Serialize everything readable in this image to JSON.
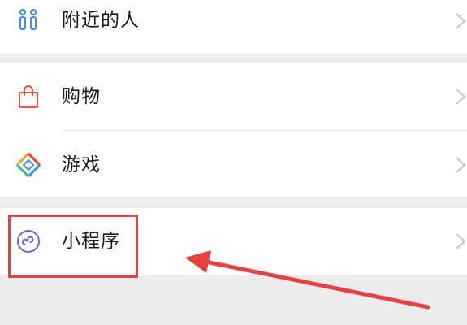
{
  "menu": {
    "items": [
      {
        "label": "附近的人",
        "icon": "people-nearby-icon"
      },
      {
        "label": "购物",
        "icon": "shopping-bag-icon"
      },
      {
        "label": "游戏",
        "icon": "games-diamond-icon"
      },
      {
        "label": "小程序",
        "icon": "mini-program-icon"
      }
    ]
  },
  "colors": {
    "background": "#ededed",
    "row_background": "#ffffff",
    "text": "#1a1a1a",
    "people_icon": "#3b8df0",
    "shopping_icon": "#f0533f",
    "mini_program_icon": "#6a67ce",
    "annotation": "#e8423f",
    "chevron": "#c4c4c4"
  },
  "annotation": {
    "target": "小程序",
    "style": "red box with arrow"
  }
}
